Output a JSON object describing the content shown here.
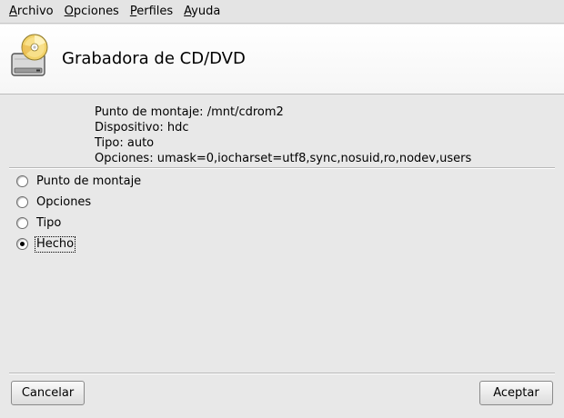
{
  "menubar": {
    "items": [
      {
        "mnemonic": "A",
        "rest": "rchivo"
      },
      {
        "mnemonic": "O",
        "rest": "pciones"
      },
      {
        "mnemonic": "P",
        "rest": "erfiles"
      },
      {
        "mnemonic": "A",
        "rest": "yuda"
      }
    ]
  },
  "header": {
    "icon": "cd-drive-icon",
    "title": "Grabadora de CD/DVD"
  },
  "info": {
    "mount_point": "Punto de montaje: /mnt/cdrom2",
    "device": "Dispositivo: hdc",
    "type": "Tipo: auto",
    "options": "Opciones: umask=0,iocharset=utf8,sync,nosuid,ro,nodev,users"
  },
  "radios": [
    {
      "label": "Punto de montaje",
      "checked": false
    },
    {
      "label": "Opciones",
      "checked": false
    },
    {
      "label": "Tipo",
      "checked": false
    },
    {
      "label": "Hecho",
      "checked": true
    }
  ],
  "buttons": {
    "cancel": "Cancelar",
    "accept": "Aceptar"
  }
}
